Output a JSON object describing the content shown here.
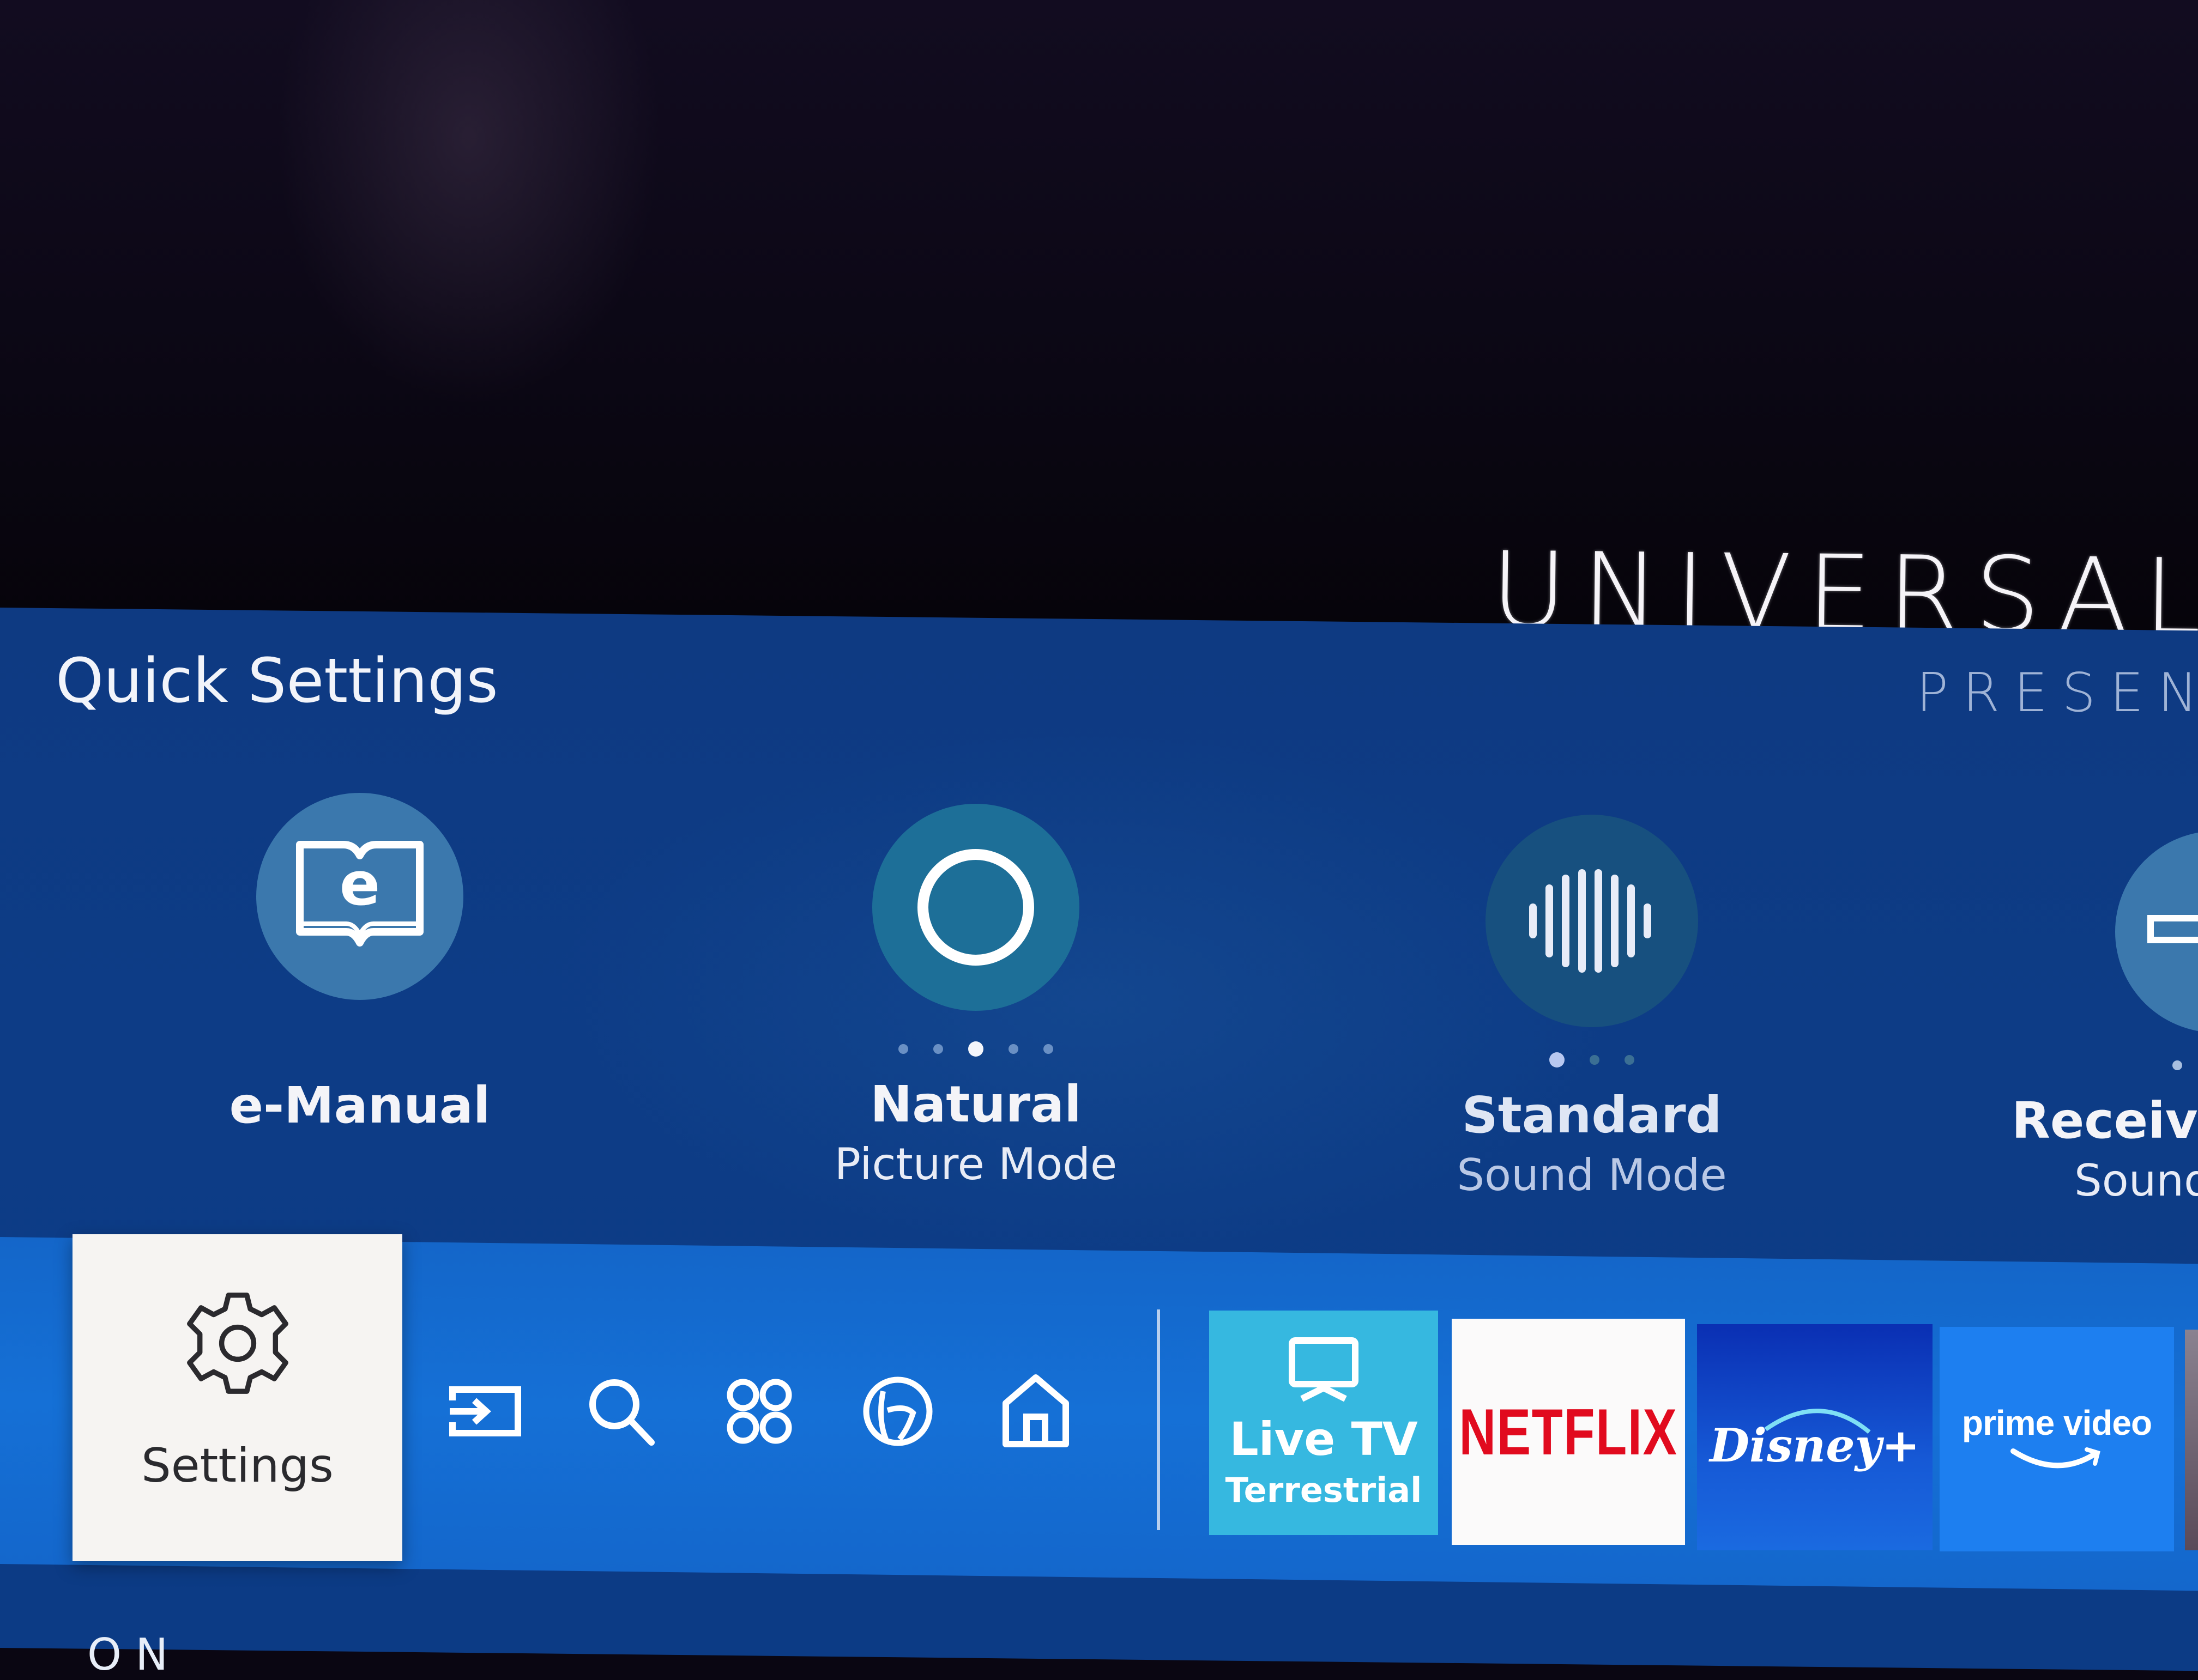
{
  "background_video": {
    "title_text": "UNIVERSAL P",
    "subtitle_text": "PRESEN"
  },
  "quick_settings": {
    "title": "Quick Settings",
    "items": [
      {
        "icon": "e-manual-book-icon",
        "label": "e-Manual",
        "sublabel": ""
      },
      {
        "icon": "picture-mode-circle-icon",
        "label": "Natural",
        "sublabel": "Picture Mode",
        "option_count": 5,
        "selected_index": 2
      },
      {
        "icon": "sound-wave-icon",
        "label": "Standard",
        "sublabel": "Sound Mode",
        "option_count": 3,
        "selected_index": 0
      },
      {
        "icon": "sound-output-icon",
        "label": "Receive",
        "sublabel": "Sound",
        "truncated": true
      }
    ]
  },
  "nav_bar": {
    "settings_tile": {
      "label": "Settings",
      "icon": "gear-icon",
      "focused": true
    },
    "icons": [
      {
        "name": "source",
        "icon": "source-input-icon"
      },
      {
        "name": "search",
        "icon": "search-icon"
      },
      {
        "name": "apps",
        "icon": "apps-grid-icon"
      },
      {
        "name": "ambient",
        "icon": "ambient-mode-icon"
      },
      {
        "name": "home",
        "icon": "home-icon"
      }
    ],
    "apps": [
      {
        "name": "Live TV",
        "sublabel": "Terrestrial",
        "icon": "tv-icon",
        "color": "#36b8e0"
      },
      {
        "name": "NETFLIX",
        "color": "#fbfafa",
        "text_color": "#e10a1e"
      },
      {
        "name": "Disney+",
        "color": "#0a2fb3"
      },
      {
        "name": "prime video",
        "color": "#1d7ff0"
      }
    ]
  },
  "bottom_peek_text": "O N",
  "colors": {
    "panel": "#0d3c86",
    "nav_bar": "#1570d6",
    "settings_tile": "#f6f4f2",
    "accent_circle": "#3a7bb0",
    "active_circle": "#1d6f98"
  }
}
